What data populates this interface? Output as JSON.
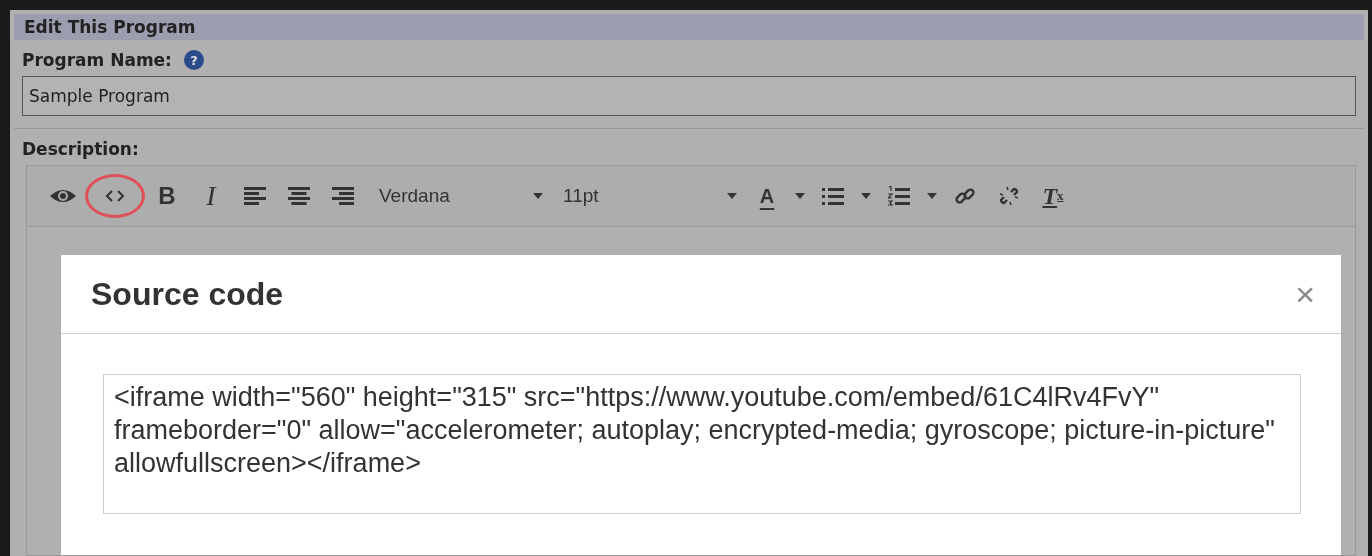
{
  "panel": {
    "title": "Edit This Program"
  },
  "program_name": {
    "label": "Program Name:",
    "help": "?",
    "value": "Sample Program"
  },
  "description": {
    "label": "Description:"
  },
  "toolbar": {
    "code_highlighted": true,
    "bold": "B",
    "italic": "I",
    "font": "Verdana",
    "size": "11pt",
    "text_color": "A",
    "clear_format": "T",
    "clear_format_sub": "x"
  },
  "dialog": {
    "title": "Source code",
    "close": "×",
    "code": "<iframe width=\"560\" height=\"315\" src=\"https://www.youtube.com/embed/61C4lRv4FvY\" frameborder=\"0\" allow=\"accelerometer; autoplay; encrypted-media; gyroscope; picture-in-picture\" allowfullscreen></iframe>"
  }
}
